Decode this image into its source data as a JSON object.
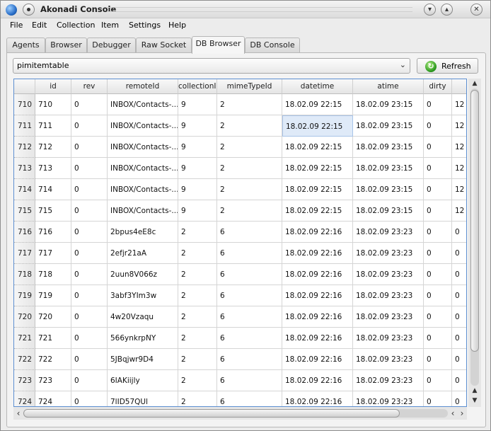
{
  "window": {
    "title": "Akonadi Console"
  },
  "menubar": [
    "File",
    "Edit",
    "Collection",
    "Item",
    "Settings",
    "Help"
  ],
  "tabs": [
    "Agents",
    "Browser",
    "Debugger",
    "Raw Socket",
    "DB Browser",
    "DB Console"
  ],
  "active_tab": "DB Browser",
  "table_select": {
    "value": "pimitemtable"
  },
  "refresh_button": {
    "label": "Refresh",
    "icon": "refresh-icon"
  },
  "table": {
    "columns": [
      "id",
      "rev",
      "remoteId",
      "collectionId",
      "mimeTypeId",
      "datetime",
      "atime",
      "dirty"
    ],
    "header_truncated": {
      "collectionId": "collectionIc"
    },
    "rows": [
      {
        "row": "710",
        "cells": [
          "710",
          "0",
          "INBOX/Contacts-...",
          "9",
          "2",
          "18.02.09 22:15",
          "18.02.09 23:15",
          "0",
          "12"
        ]
      },
      {
        "row": "711",
        "cells": [
          "711",
          "0",
          "INBOX/Contacts-...",
          "9",
          "2",
          "18.02.09 22:15",
          "18.02.09 23:15",
          "0",
          "12"
        ]
      },
      {
        "row": "712",
        "cells": [
          "712",
          "0",
          "INBOX/Contacts-...",
          "9",
          "2",
          "18.02.09 22:15",
          "18.02.09 23:15",
          "0",
          "12"
        ]
      },
      {
        "row": "713",
        "cells": [
          "713",
          "0",
          "INBOX/Contacts-...",
          "9",
          "2",
          "18.02.09 22:15",
          "18.02.09 23:15",
          "0",
          "12"
        ]
      },
      {
        "row": "714",
        "cells": [
          "714",
          "0",
          "INBOX/Contacts-...",
          "9",
          "2",
          "18.02.09 22:15",
          "18.02.09 23:15",
          "0",
          "12"
        ]
      },
      {
        "row": "715",
        "cells": [
          "715",
          "0",
          "INBOX/Contacts-...",
          "9",
          "2",
          "18.02.09 22:15",
          "18.02.09 23:15",
          "0",
          "12"
        ]
      },
      {
        "row": "716",
        "cells": [
          "716",
          "0",
          "2bpus4eE8c",
          "2",
          "6",
          "18.02.09 22:16",
          "18.02.09 23:23",
          "0",
          "0"
        ]
      },
      {
        "row": "717",
        "cells": [
          "717",
          "0",
          "2efjr21aA",
          "2",
          "6",
          "18.02.09 22:16",
          "18.02.09 23:23",
          "0",
          "0"
        ]
      },
      {
        "row": "718",
        "cells": [
          "718",
          "0",
          "2uun8V066z",
          "2",
          "6",
          "18.02.09 22:16",
          "18.02.09 23:23",
          "0",
          "0"
        ]
      },
      {
        "row": "719",
        "cells": [
          "719",
          "0",
          "3abf3YIm3w",
          "2",
          "6",
          "18.02.09 22:16",
          "18.02.09 23:23",
          "0",
          "0"
        ]
      },
      {
        "row": "720",
        "cells": [
          "720",
          "0",
          "4w20Vzaqu",
          "2",
          "6",
          "18.02.09 22:16",
          "18.02.09 23:23",
          "0",
          "0"
        ]
      },
      {
        "row": "721",
        "cells": [
          "721",
          "0",
          "566ynkrpNY",
          "2",
          "6",
          "18.02.09 22:16",
          "18.02.09 23:23",
          "0",
          "0"
        ]
      },
      {
        "row": "722",
        "cells": [
          "722",
          "0",
          "5JBqjwr9D4",
          "2",
          "6",
          "18.02.09 22:16",
          "18.02.09 23:23",
          "0",
          "0"
        ]
      },
      {
        "row": "723",
        "cells": [
          "723",
          "0",
          "6IAKiijly",
          "2",
          "6",
          "18.02.09 22:16",
          "18.02.09 23:23",
          "0",
          "0"
        ]
      },
      {
        "row": "724",
        "cells": [
          "724",
          "0",
          "7lID57QUl",
          "2",
          "6",
          "18.02.09 22:16",
          "18.02.09 23:23",
          "0",
          "0"
        ]
      }
    ],
    "selected_cell": {
      "row": "711",
      "column": "datetime"
    }
  },
  "colors": {
    "selection": "#dfeaf8",
    "frame_border": "#5d8fd1"
  }
}
